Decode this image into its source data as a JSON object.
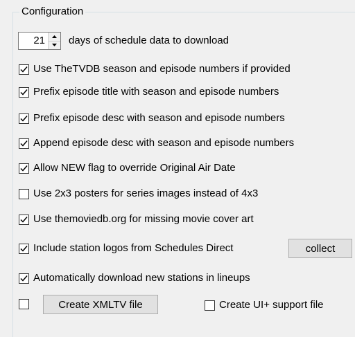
{
  "group": {
    "title": "Configuration"
  },
  "days": {
    "value": "21",
    "label": "days of schedule data to download"
  },
  "options": [
    {
      "label": "Use TheTVDB season and episode numbers if provided",
      "checked": true
    },
    {
      "label": "Prefix episode title with season and episode numbers",
      "checked": true
    },
    {
      "label": "Prefix episode desc with season and episode numbers",
      "checked": true
    },
    {
      "label": "Append episode desc with season and episode numbers",
      "checked": true
    },
    {
      "label": "Allow NEW flag to override Original Air Date",
      "checked": true
    },
    {
      "label": "Use 2x3 posters for series images instead of 4x3",
      "checked": false
    },
    {
      "label": "Use themoviedb.org for missing movie cover art",
      "checked": true
    },
    {
      "label": "Include station logos from Schedules Direct",
      "checked": true
    },
    {
      "label": "Automatically download new stations in lineups",
      "checked": true
    }
  ],
  "collect_button": "collect",
  "xmltv": {
    "checked": false,
    "button": "Create XMLTV file"
  },
  "uiplus": {
    "label": "Create UI+ support file",
    "checked": false
  },
  "colors": {
    "groupbox_border": "#d5dfe5",
    "background": "#f0f0f0",
    "button_face": "#e1e1e1"
  }
}
